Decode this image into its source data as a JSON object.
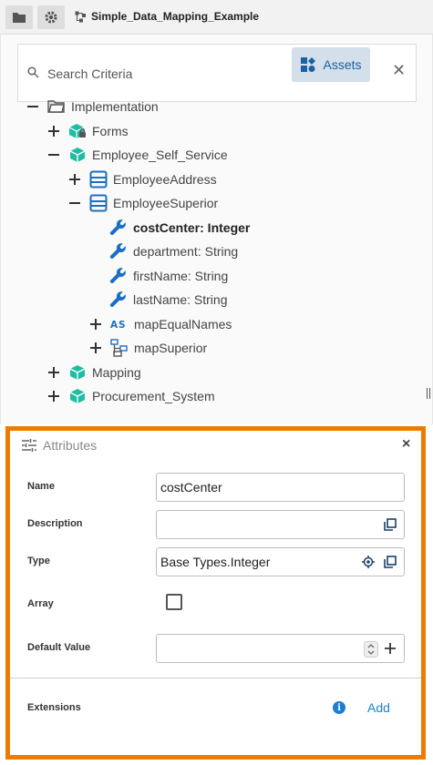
{
  "tab": {
    "title": "Simple_Data_Mapping_Example"
  },
  "search": {
    "placeholder": "Search Criteria",
    "assets_label": "Assets"
  },
  "tree": {
    "implementation": "Implementation",
    "forms": "Forms",
    "ess": "Employee_Self_Service",
    "employee_address": "EmployeeAddress",
    "employee_superior": "EmployeeSuperior",
    "attr_costcenter": "costCenter: Integer",
    "attr_department": "department: String",
    "attr_firstname": "firstName: String",
    "attr_lastname": "lastName: String",
    "map_equal_names": "mapEqualNames",
    "map_superior": "mapSuperior",
    "mapping": "Mapping",
    "procurement": "Procurement_System"
  },
  "attributes": {
    "title": "Attributes",
    "name_label": "Name",
    "name_value": "costCenter",
    "description_label": "Description",
    "description_value": "",
    "type_label": "Type",
    "type_value": "Base Types.Integer",
    "array_label": "Array",
    "default_label": "Default Value",
    "default_value": "",
    "extensions_label": "Extensions",
    "add_label": "Add"
  },
  "colors": {
    "accent": "#1a62a6",
    "highlight_border": "#ef7a00",
    "icon_teal": "#1fbda2",
    "icon_blue": "#1a6fc4"
  }
}
